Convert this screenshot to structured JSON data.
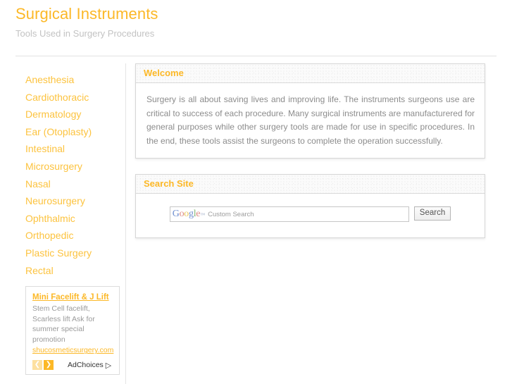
{
  "header": {
    "title": "Surgical Instruments",
    "tagline": "Tools Used in Surgery Procedures"
  },
  "sidebar": {
    "items": [
      {
        "label": "Anesthesia"
      },
      {
        "label": "Cardiothoracic"
      },
      {
        "label": "Dermatology"
      },
      {
        "label": "Ear (Otoplasty)"
      },
      {
        "label": "Intestinal"
      },
      {
        "label": "Microsurgery"
      },
      {
        "label": "Nasal"
      },
      {
        "label": "Neurosurgery"
      },
      {
        "label": "Ophthalmic"
      },
      {
        "label": "Orthopedic"
      },
      {
        "label": "Plastic Surgery"
      },
      {
        "label": "Rectal"
      }
    ]
  },
  "welcome": {
    "title": "Welcome",
    "body": "Surgery is all about saving lives and improving life. The instruments surgeons use are critical to success of each procedure. Many surgical instruments are manufacturered for general purposes while other surgery tools are made for use in specific procedures. In the end, these tools assist the surgeons to complete the operation successfully."
  },
  "search": {
    "title": "Search Site",
    "logo_letters": [
      "G",
      "o",
      "o",
      "g",
      "l",
      "e"
    ],
    "trademark": "™",
    "placeholder": "Custom Search",
    "button_label": "Search"
  },
  "ad": {
    "title": "Mini Facelift & J Lift",
    "description": "Stem Cell facelift, Scarless lift Ask for summer special promotion",
    "url": "shucosmeticsurgery.com",
    "prev_icon": "chevron-left-icon",
    "prev_glyph": "❮",
    "next_icon": "chevron-right-icon",
    "next_glyph": "❯",
    "adchoices_label": "AdChoices",
    "adchoices_glyph": "▷"
  },
  "colors": {
    "accent": "#fcb827",
    "nav_link": "#fcc33f",
    "text": "#8c8c8c",
    "tagline": "#c3c3c3",
    "panel_border": "#d6d6d6"
  }
}
